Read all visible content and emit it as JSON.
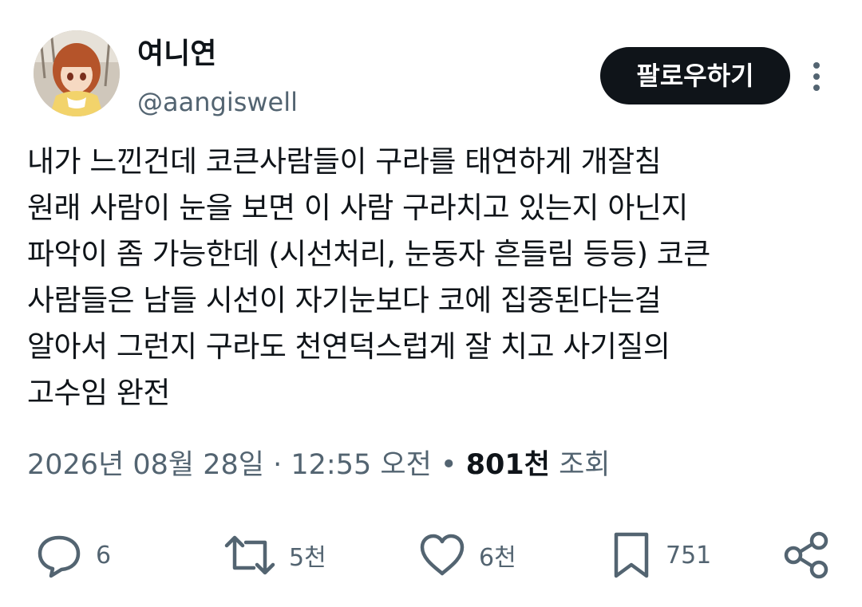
{
  "user": {
    "display_name": "여니연",
    "handle": "@aangiswell"
  },
  "follow_button": {
    "label": "팔로우하기"
  },
  "tweet": {
    "lines": [
      "내가 느낀건데 코큰사람들이 구라를 태연하게 개잘침",
      "원래 사람이 눈을 보면 이 사람 구라치고 있는지 아닌지",
      "파악이 좀 가능한데 (시선처리, 눈동자 흔들림 등등) 코큰",
      "사람들은 남들 시선이 자기눈보다 코에 집중된다는걸",
      "알아서 그런지 구라도 천연덕스럽게 잘 치고 사기질의",
      "고수임 완전"
    ]
  },
  "meta": {
    "date": "2026년 08월 28일",
    "dot1": " · ",
    "time": "12:55 오전",
    "dot2": " • ",
    "views_count": "801천",
    "views_label": " 조회"
  },
  "actions": {
    "reply": {
      "icon": "reply-icon",
      "count": "6"
    },
    "retweet": {
      "icon": "retweet-icon",
      "count": "5천"
    },
    "like": {
      "icon": "heart-icon",
      "count": "6천"
    },
    "bookmark": {
      "icon": "bookmark-icon",
      "count": "751"
    },
    "share": {
      "icon": "share-icon"
    }
  },
  "colors": {
    "text_primary": "#0f1419",
    "text_secondary": "#536471",
    "button_bg": "#0f1419",
    "button_text": "#ffffff"
  }
}
